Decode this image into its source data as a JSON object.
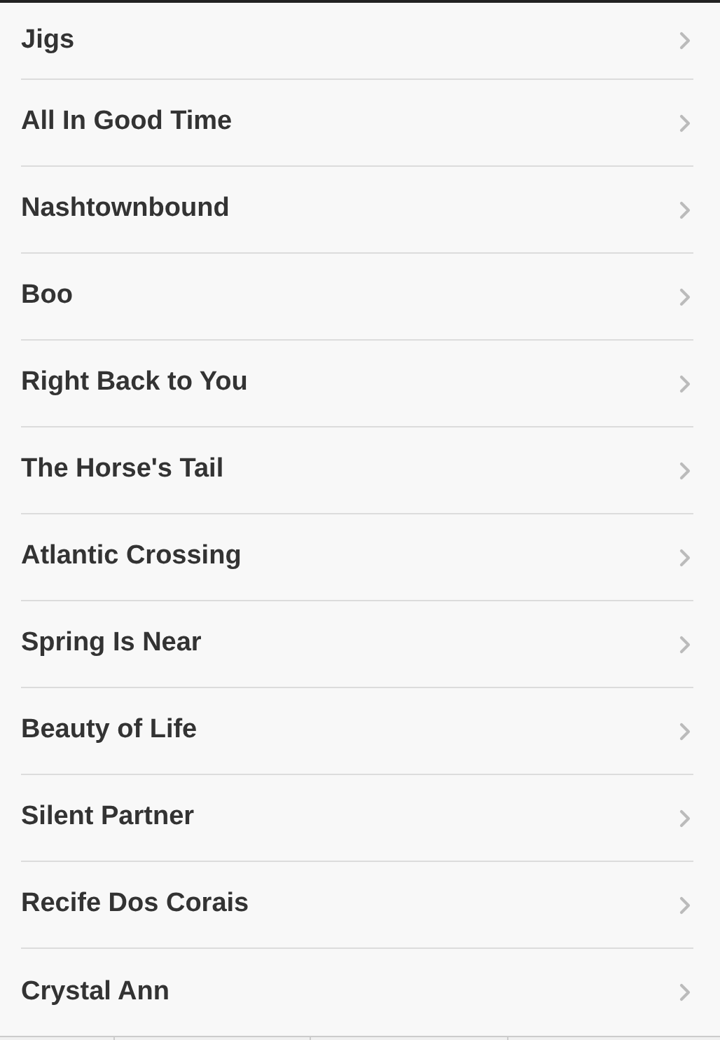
{
  "songs": [
    {
      "title": "Jigs"
    },
    {
      "title": "All In Good Time"
    },
    {
      "title": "Nashtownbound"
    },
    {
      "title": "Boo"
    },
    {
      "title": "Right Back to You"
    },
    {
      "title": "The Horse's Tail"
    },
    {
      "title": "Atlantic Crossing"
    },
    {
      "title": "Spring Is Near"
    },
    {
      "title": "Beauty of Life"
    },
    {
      "title": "Silent Partner"
    },
    {
      "title": "Recife Dos Corais"
    },
    {
      "title": "Crystal Ann"
    }
  ]
}
